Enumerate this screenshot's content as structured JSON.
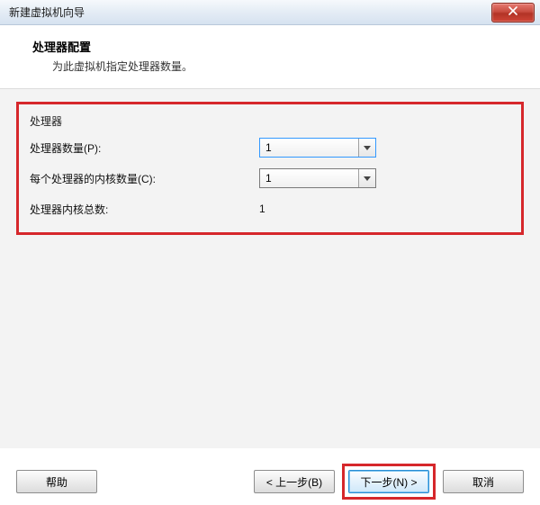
{
  "window": {
    "title": "新建虚拟机向导"
  },
  "header": {
    "title": "处理器配置",
    "subtitle": "为此虚拟机指定处理器数量。"
  },
  "form": {
    "group_label": "处理器",
    "processor_count_label": "处理器数量(P):",
    "processor_count_value": "1",
    "cores_per_label": "每个处理器的内核数量(C):",
    "cores_per_value": "1",
    "total_label": "处理器内核总数:",
    "total_value": "1"
  },
  "buttons": {
    "help": "帮助",
    "back": "< 上一步(B)",
    "next": "下一步(N) >",
    "cancel": "取消"
  }
}
